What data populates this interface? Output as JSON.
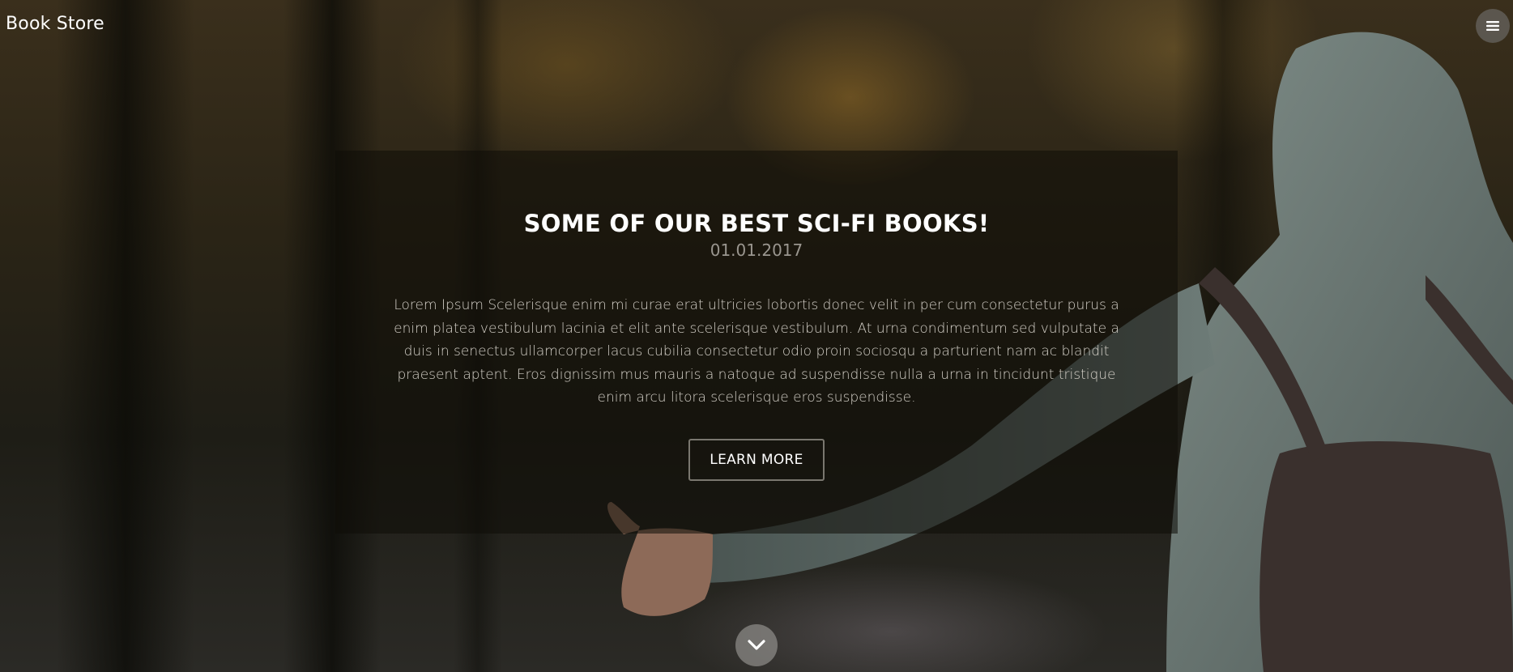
{
  "navbar": {
    "brand": "Book Store",
    "menu_icon": "hamburger-menu-icon"
  },
  "hero": {
    "title": "SOME OF OUR BEST SCI-FI BOOKS!",
    "date": "01.01.2017",
    "body": "Lorem Ipsum Scelerisque enim mi curae erat ultricies lobortis donec velit in per cum consectetur purus a enim platea vestibulum lacinia et elit ante scelerisque vestibulum. At urna condimentum sed vulputate a duis in senectus ullamcorper lacus cubilia consectetur odio proin sociosqu a parturient nam ac blandit praesent aptent. Eros dignissim mus mauris a natoque ad suspendisse nulla a urna in tincidunt tristique enim arcu litora scelerisque eros suspendisse.",
    "button_label": "LEARN MORE"
  },
  "scroll_down": {
    "icon": "chevron-down-icon"
  }
}
